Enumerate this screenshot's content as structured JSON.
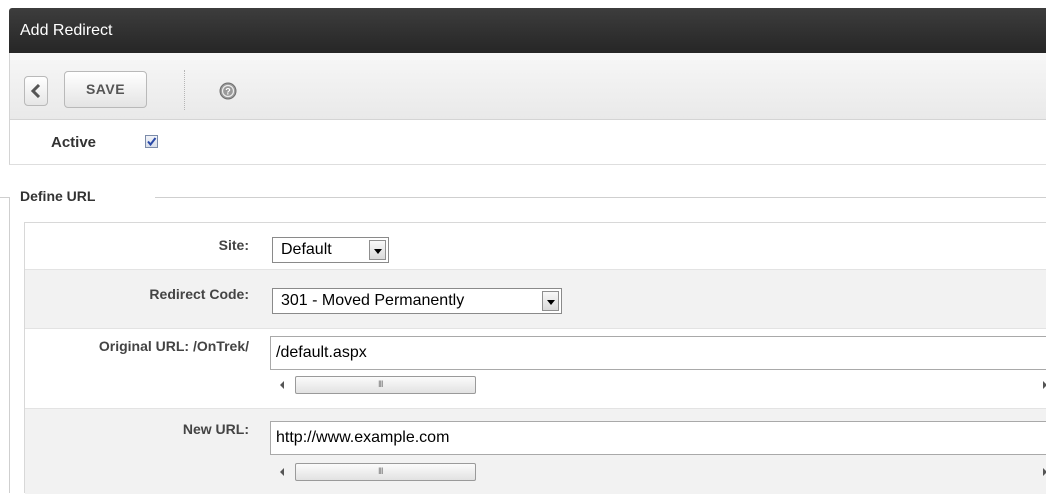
{
  "window": {
    "title": "Add Redirect"
  },
  "toolbar": {
    "back_icon": "chevron-left-icon",
    "save_label": "SAVE",
    "help_icon": "help-icon"
  },
  "active": {
    "label": "Active",
    "checked": true
  },
  "section": {
    "title": "Define URL"
  },
  "form": {
    "site": {
      "label": "Site:",
      "value": "Default"
    },
    "redirect_code": {
      "label": "Redirect Code:",
      "value": "301 - Moved Permanently"
    },
    "original_url": {
      "label": "Original URL: /OnTrek/",
      "value": "/default.aspx"
    },
    "new_url": {
      "label": "New URL:",
      "value": "http://www.example.com"
    }
  },
  "colors": {
    "titlebar": "#2e2e2e",
    "checkbox_check": "#2a4aa8"
  }
}
